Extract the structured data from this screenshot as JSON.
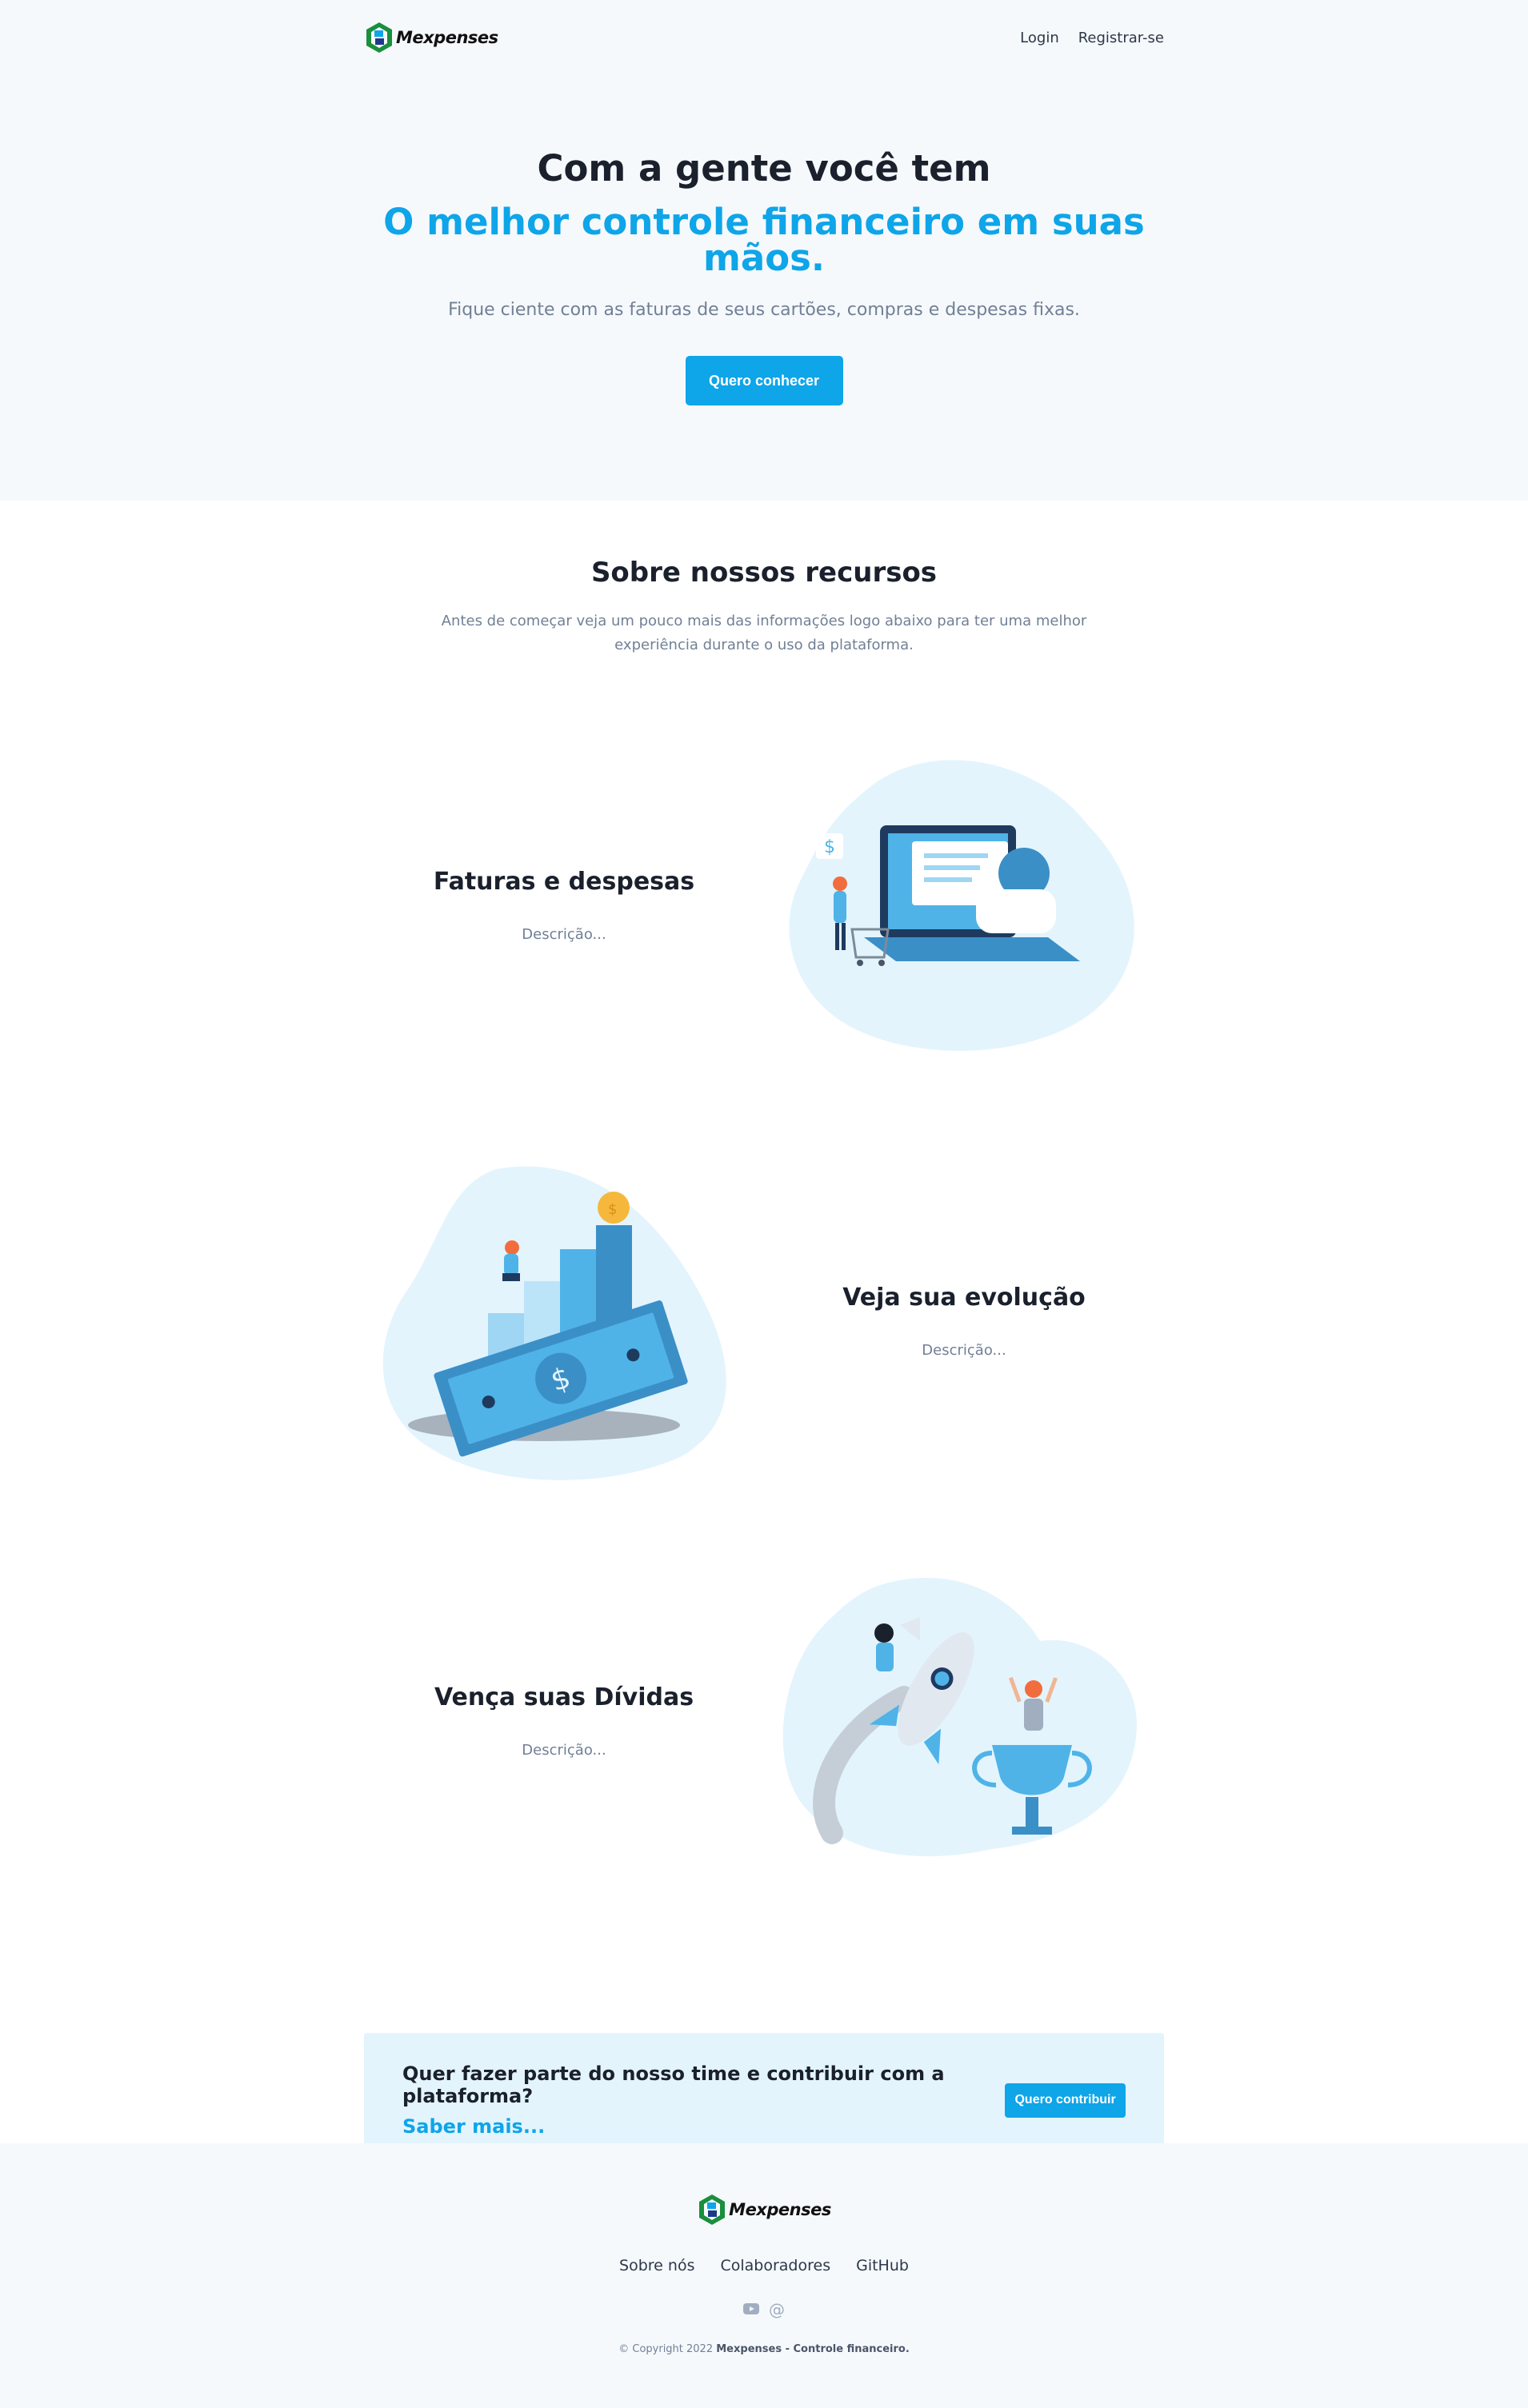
{
  "brand": {
    "name": "Mexpenses"
  },
  "nav": {
    "login": "Login",
    "register": "Registrar-se"
  },
  "hero": {
    "title": "Com a gente você tem",
    "title_accent": "O melhor controle financeiro em suas mãos.",
    "subtitle": "Fique ciente com as faturas de seus cartões, compras e despesas fixas.",
    "cta": "Quero conhecer"
  },
  "features": {
    "title": "Sobre nossos recursos",
    "subtitle": "Antes de começar veja um pouco mais das informações logo abaixo para ter uma melhor experiência durante o uso da plataforma.",
    "items": [
      {
        "title": "Faturas e despesas",
        "desc": "Descrição..."
      },
      {
        "title": "Veja sua evolução",
        "desc": "Descrição..."
      },
      {
        "title": "Vença suas Dívidas",
        "desc": "Descrição..."
      }
    ]
  },
  "cta": {
    "question": "Quer fazer parte do nosso time e contribuir com a plataforma?",
    "link": "Saber mais...",
    "button": "Quero contribuir"
  },
  "footer": {
    "links": [
      "Sobre nós",
      "Colaboradores",
      "GitHub"
    ],
    "social_icons": [
      "youtube-icon",
      "at-icon"
    ],
    "copyright_prefix": "© Copyright 2022",
    "copyright_brand": "Mexpenses - Controle financeiro."
  },
  "colors": {
    "accent": "#0ea5e9",
    "hero_bg": "#f6f9fc",
    "cta_bg": "#e3f4fd"
  }
}
